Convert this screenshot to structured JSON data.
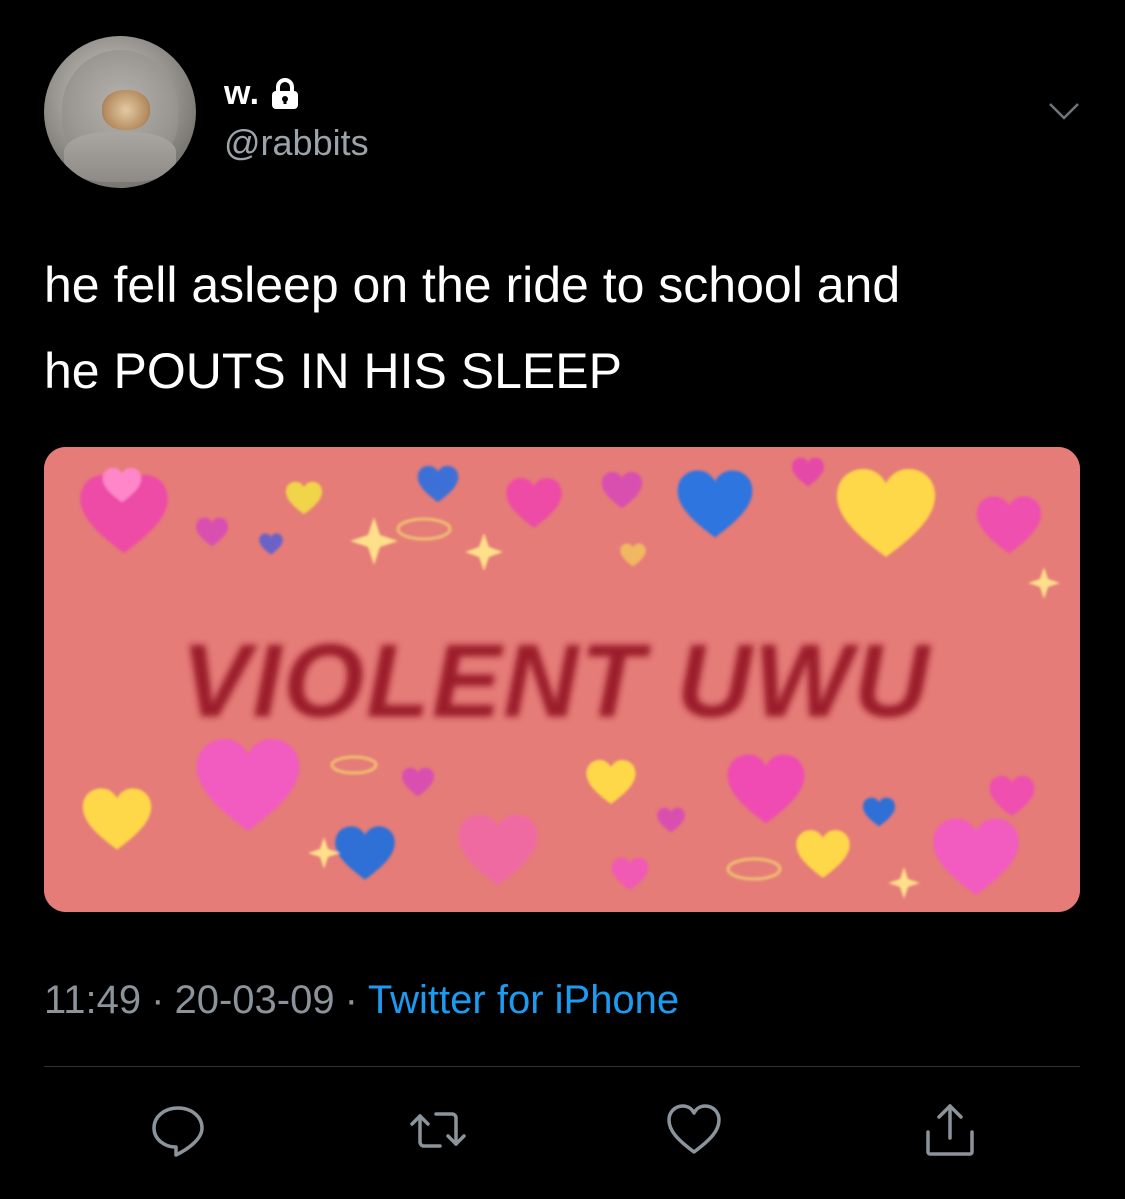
{
  "header": {
    "display_name": "w.",
    "handle": "@rabbits",
    "icons": {
      "protected": "lock-icon",
      "menu": "chevron-down-icon"
    }
  },
  "tweet": {
    "text_line1": "he fell asleep on the ride to school and",
    "text_line2": "he POUTS IN HIS SLEEP"
  },
  "media": {
    "caption_text": "VIOLENT UWU",
    "background_color": "#e57c78"
  },
  "meta": {
    "time": "11:49",
    "separator": "·",
    "date": "20-03-09",
    "source": "Twitter for iPhone",
    "source_color": "#1d9bf0"
  },
  "actions": {
    "icons": [
      "reply-icon",
      "retweet-icon",
      "like-icon",
      "share-icon"
    ]
  },
  "colors": {
    "background": "#000000",
    "text_primary": "#ffffff",
    "text_secondary": "#8b939b",
    "divider": "#2f3336"
  }
}
